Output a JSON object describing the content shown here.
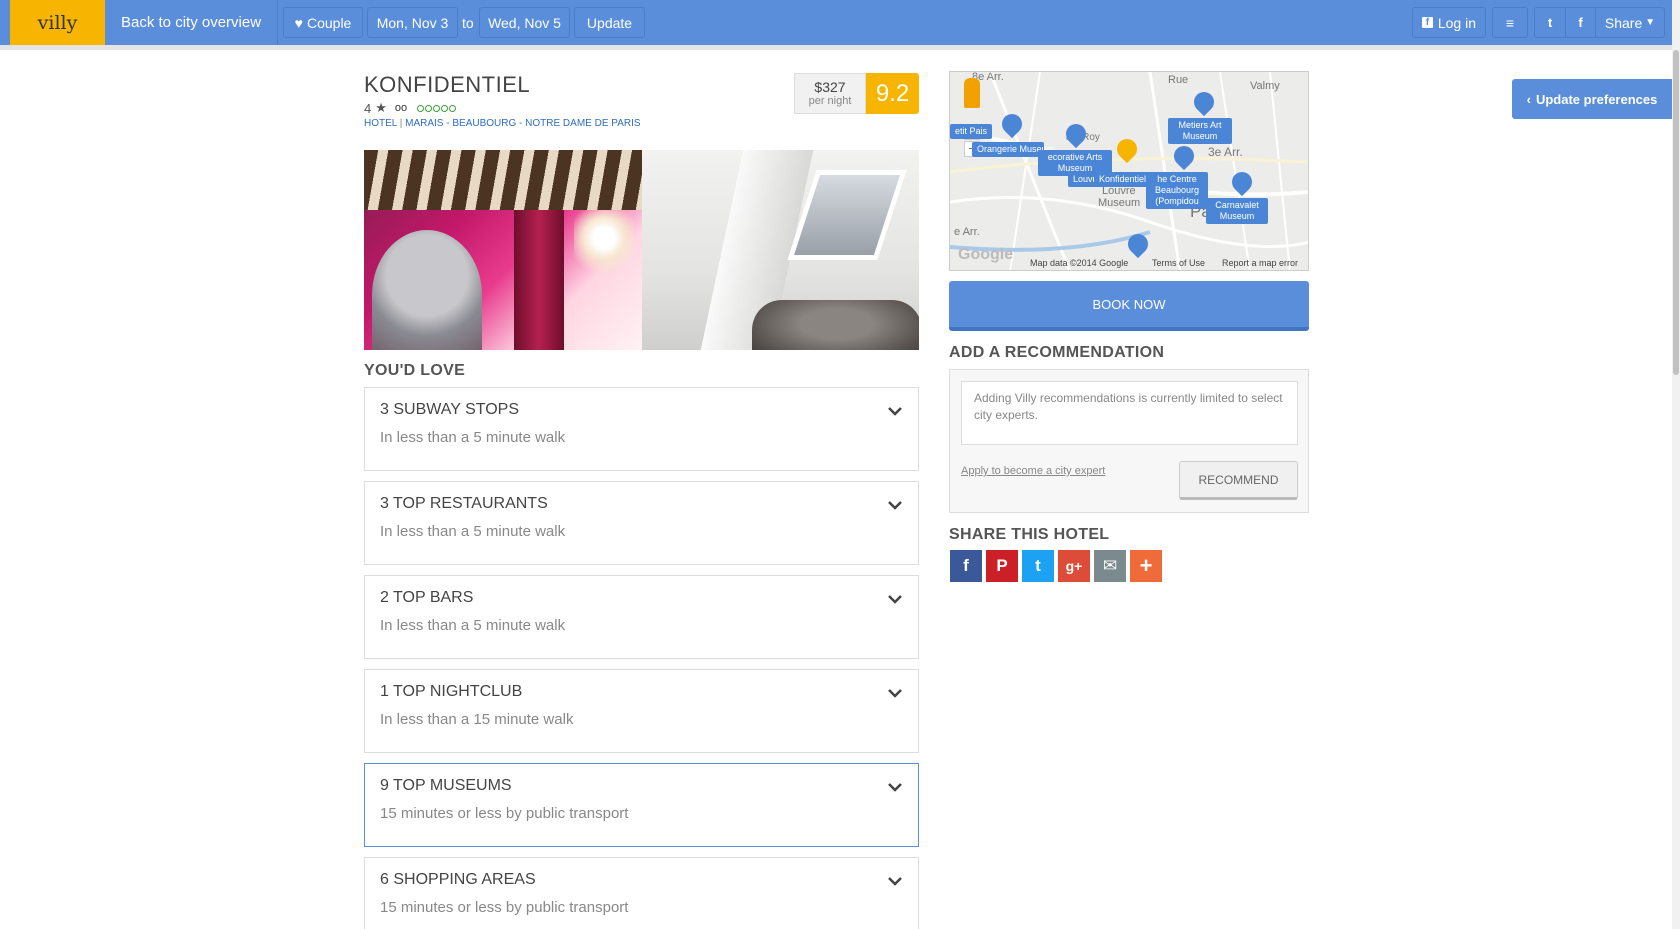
{
  "topbar": {
    "logo": "villy",
    "back_link": "Back to city overview",
    "couple_label": "Couple",
    "date_from": "Mon, Nov 3",
    "date_to_sep": "to",
    "date_to": "Wed, Nov 5",
    "update_label": "Update",
    "login_label": "Log in",
    "share_label": "Share"
  },
  "update_preferences": "Update preferences",
  "hotel": {
    "name": "KONFIDENTIEL",
    "stars": "4",
    "tags": [
      "HOTEL",
      "MARAIS - BEAUBOURG - NOTRE DAME DE PARIS"
    ],
    "price": "$327",
    "price_label": "per night",
    "score": "9.2"
  },
  "youd_love": {
    "title": "YOU'D LOVE",
    "items": [
      {
        "title": "3 SUBWAY STOPS",
        "subtitle": "In less than a 5 minute walk"
      },
      {
        "title": "3 TOP RESTAURANTS",
        "subtitle": "In less than a 5 minute walk"
      },
      {
        "title": "2 TOP BARS",
        "subtitle": "In less than a 5 minute walk"
      },
      {
        "title": "1 TOP NIGHTCLUB",
        "subtitle": "In less than a 15 minute walk"
      },
      {
        "title": "9 TOP MUSEUMS",
        "subtitle": "15 minutes or less by public transport"
      },
      {
        "title": "6 SHOPPING AREAS",
        "subtitle": "15 minutes or less by public transport"
      }
    ]
  },
  "map": {
    "labels": {
      "arr_top": "8e Arr.",
      "rue": "Rue",
      "valmy": "Valmy",
      "arr3": "3e Arr.",
      "paris": "Paris",
      "arr_bottom": "e Arr.",
      "louvre": "Louvre",
      "museum": "Museum",
      "palais": "ais-Roy"
    },
    "pins": {
      "orangerie": "Orangerie Museum",
      "decorative": "ecorative Arts Museum",
      "konfidentiel": "Konfidentiel",
      "metiers": "Metiers Art Museum",
      "centre": "he Centre Beaubourg (Pompidou",
      "carnavalet": "Carnavalet Museum",
      "petit": "etit Pais",
      "louvr": "Louvr"
    },
    "zoom_in": "+",
    "zoom_out": "−",
    "google": "Google",
    "footer_data": "Map data ©2014 Google",
    "footer_terms": "Terms of Use",
    "footer_report": "Report a map error"
  },
  "book_now": "BOOK NOW",
  "recommendation": {
    "title": "ADD A RECOMMENDATION",
    "placeholder": "Adding Villy recommendations is currently limited to select city experts.",
    "apply_link": "Apply to become a city expert",
    "button": "RECOMMEND"
  },
  "share": {
    "title": "SHARE THIS HOTEL",
    "icons": [
      {
        "name": "facebook-icon",
        "glyph": "f",
        "color": "#3b5998"
      },
      {
        "name": "pinterest-icon",
        "glyph": "P",
        "color": "#cb2027"
      },
      {
        "name": "twitter-icon",
        "glyph": "t",
        "color": "#1da1f2"
      },
      {
        "name": "google-plus-icon",
        "glyph": "g+",
        "color": "#dd4b39"
      },
      {
        "name": "email-icon",
        "glyph": "✉",
        "color": "#7a8a8f"
      },
      {
        "name": "more-share-icon",
        "glyph": "+",
        "color": "#f06b3a"
      }
    ]
  },
  "colors": {
    "brand_blue": "#5a8edb",
    "brand_yellow": "#f7b400"
  }
}
